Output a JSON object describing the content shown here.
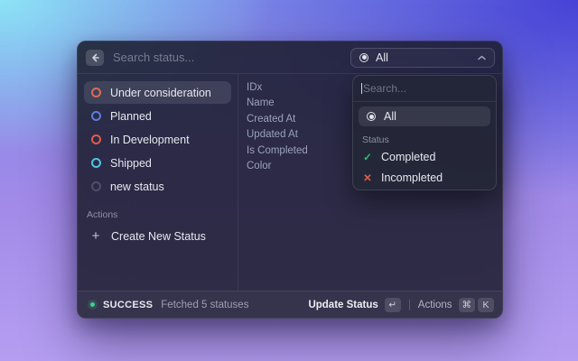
{
  "colors": {
    "bg_cyan": "#8ce4f6",
    "bg_indigo": "#4642d6",
    "bg_purple": "#a18ae8",
    "bg_purple_light": "#b59ef1",
    "success_green": "#3ecf8e",
    "check_green": "#2ebd72",
    "cross_red": "#e05e49",
    "selected_row": "rgba(255,255,255,0.10)"
  },
  "topbar": {
    "search_placeholder": "Search status...",
    "filter": {
      "selected": "All"
    }
  },
  "sidebar": {
    "items": [
      {
        "label": "Under consideration",
        "color": "#dd6a57",
        "selected": true
      },
      {
        "label": "Planned",
        "color": "#5b7ed9",
        "selected": false
      },
      {
        "label": "In Development",
        "color": "#de5c4a",
        "selected": false
      },
      {
        "label": "Shipped",
        "color": "#4fc4e3",
        "selected": false
      },
      {
        "label": "new status",
        "color": "#4a5166",
        "selected": false
      }
    ],
    "actions_header": "Actions",
    "create_action": "Create New Status",
    "plus_glyph": "+"
  },
  "details": {
    "fields": [
      "IDx",
      "Name",
      "Created At",
      "Updated At",
      "Is Completed",
      "Color"
    ]
  },
  "dropdown": {
    "search_placeholder": "Search...",
    "all_option": "All",
    "section_label": "Status",
    "options": [
      {
        "label": "Completed",
        "glyph": "✓",
        "color": "#2ebd72"
      },
      {
        "label": "Incompleted",
        "glyph": "✕",
        "color": "#e05e49"
      }
    ]
  },
  "statusbar": {
    "status": "SUCCESS",
    "message": "Fetched 5 statuses",
    "primary_action": "Update Status",
    "return_key": "↵",
    "secondary_action": "Actions",
    "cmd_key": "⌘",
    "k_key": "K"
  }
}
